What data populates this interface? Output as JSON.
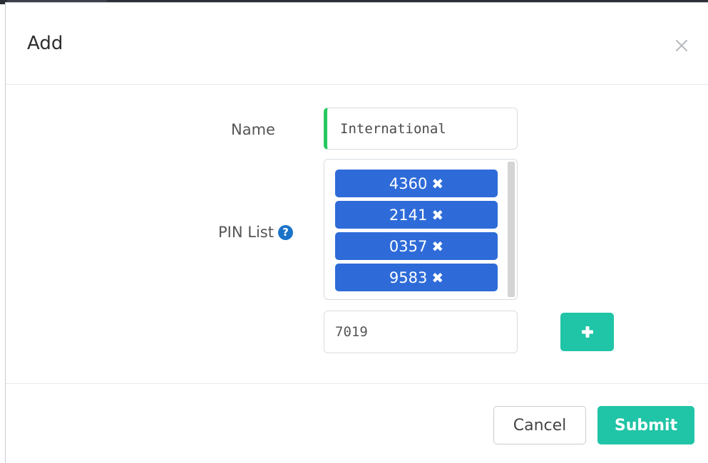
{
  "dialog": {
    "title": "Add"
  },
  "form": {
    "name_label": "Name",
    "name_value": "International",
    "pin_list_label": "PIN List",
    "pins": [
      "4360",
      "2141",
      "0357",
      "9583"
    ],
    "pin_input_value": "7019"
  },
  "footer": {
    "cancel_label": "Cancel",
    "submit_label": "Submit"
  },
  "icons": {
    "close": "close-icon",
    "help": "question-circle-icon",
    "remove": "times-icon",
    "add": "plus-icon"
  },
  "colors": {
    "accent_green": "#20c4a6",
    "chip_blue": "#2e6bd9",
    "name_indicator": "#26c95f",
    "help_blue": "#1a73c8"
  }
}
